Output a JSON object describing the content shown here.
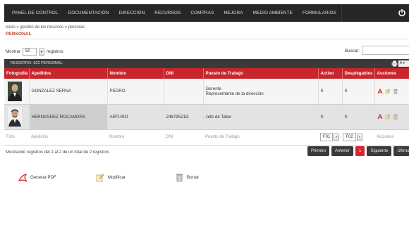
{
  "nav": {
    "items": [
      "PANEL DE CONTROL",
      "DOCUMENTACIÓN",
      "DIRECCIÓN",
      "RECURSOS",
      "COMPRAS",
      "MEJORA",
      "MEDIO AMBIENTE",
      "FORMULARIOS"
    ],
    "power_icon": "power-icon"
  },
  "breadcrumb": "inicio » gestión de los recursos » personal",
  "page_title": "PERSONAL",
  "controls": {
    "show_label": "Mostrar",
    "page_size": "50",
    "records_label": "registros",
    "search_label": "Buscar:",
    "search_value": ""
  },
  "registry_bar": {
    "label": "REGISTRO: 622   PERSONAL",
    "columns_button": "A"
  },
  "table": {
    "headers": [
      "Fotografía",
      "Apellidos",
      "Nombre",
      "DNI",
      "Puesto de Trabajo",
      "Activo",
      "Desplegables",
      "Acciones"
    ],
    "rows": [
      {
        "apellidos": "GONZALEZ SERNA",
        "nombre": "PEDRO",
        "dni": "",
        "puesto_1": "Gerente",
        "puesto_2": "Representante de la dirección",
        "activo": "S",
        "desplegables": "S"
      },
      {
        "apellidos": "HERNANDEZ ROCAMORA",
        "nombre": "ARTURO",
        "dni": "24879521G",
        "puesto_1": "Jefe de Taller",
        "puesto_2": "",
        "activo": "S",
        "desplegables": "S"
      }
    ],
    "footer": {
      "foto": "Foto",
      "apellidos": "Apellidos",
      "nombre": "Nombre",
      "dni": "DNI",
      "puesto": "Puesto de Trabajo",
      "f01": "F01",
      "f02": "F02",
      "acciones": "Acciones"
    }
  },
  "info": "Mostrando registros del 1 al 2 de un total de 2 registros",
  "pager": {
    "first": "Primero",
    "previous": "Anterior",
    "current": "1",
    "next": "Siguiente",
    "last": "Último"
  },
  "bottom_actions": {
    "pdf": "Generar PDF",
    "modify": "Modificar",
    "delete": "Borrar"
  },
  "colors": {
    "header_red": "#c8252c",
    "nav_dark": "#262626",
    "title_red": "#c0392b"
  }
}
